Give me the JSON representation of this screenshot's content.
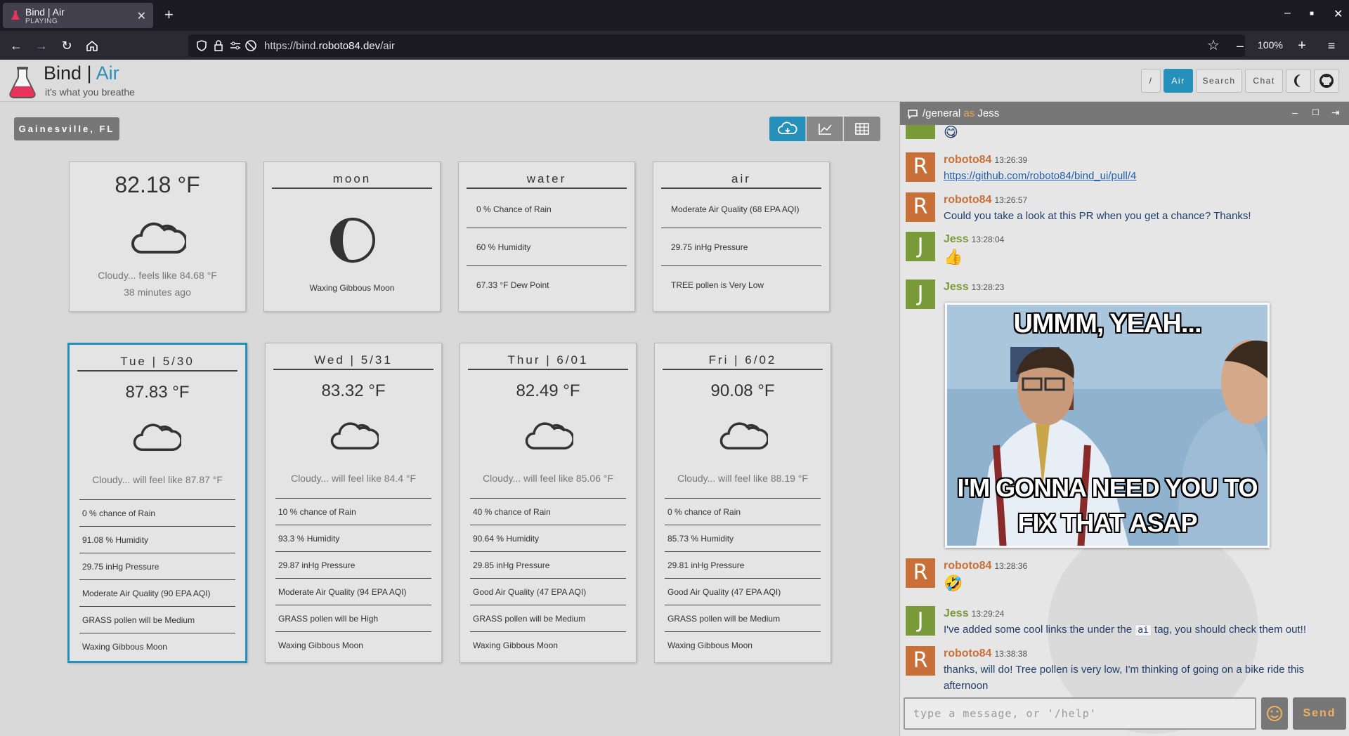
{
  "browser": {
    "tab_title": "Bind | Air",
    "tab_subtitle": "PLAYING",
    "url_prefix": "https://bind.",
    "url_domain": "roboto84.dev",
    "url_path": "/air",
    "zoom": "100%"
  },
  "app": {
    "brand_main": "Bind | ",
    "brand_accent": "Air",
    "tagline": "it's what you breathe",
    "nav": [
      {
        "label": "/"
      },
      {
        "label": "Air"
      },
      {
        "label": "Search"
      },
      {
        "label": "Chat"
      }
    ]
  },
  "location": "Gainesville, FL",
  "current": {
    "temp": "82.18 °F",
    "caption": "Cloudy... feels like 84.68 °F",
    "updated": "38 minutes ago"
  },
  "moon": {
    "title": "moon",
    "phase": "Waxing Gibbous Moon"
  },
  "water": {
    "title": "water",
    "rows": [
      "0 % Chance of Rain",
      "60 % Humidity",
      "67.33 °F Dew Point"
    ]
  },
  "air": {
    "title": "air",
    "rows": [
      "Moderate Air Quality (68 EPA AQI)",
      "29.75 inHg Pressure",
      "TREE pollen is Very Low"
    ]
  },
  "forecast": [
    {
      "day": "Tue | 5/30",
      "temp": "87.83 °F",
      "caption": "Cloudy... will feel like 87.87 °F",
      "rows": [
        "0 % chance of Rain",
        "91.08 % Humidity",
        "29.75 inHg Pressure",
        "Moderate Air Quality (90 EPA AQI)",
        "GRASS pollen will be Medium",
        "Waxing Gibbous Moon"
      ]
    },
    {
      "day": "Wed | 5/31",
      "temp": "83.32 °F",
      "caption": "Cloudy... will feel like 84.4 °F",
      "rows": [
        "10 % chance of Rain",
        "93.3 % Humidity",
        "29.87 inHg Pressure",
        "Moderate Air Quality (94 EPA AQI)",
        "GRASS pollen will be High",
        "Waxing Gibbous Moon"
      ]
    },
    {
      "day": "Thur | 6/01",
      "temp": "82.49 °F",
      "caption": "Cloudy... will feel like 85.06 °F",
      "rows": [
        "40 % chance of Rain",
        "90.64 % Humidity",
        "29.85 inHg Pressure",
        "Good Air Quality (47 EPA AQI)",
        "GRASS pollen will be Medium",
        "Waxing Gibbous Moon"
      ]
    },
    {
      "day": "Fri | 6/02",
      "temp": "90.08 °F",
      "caption": "Cloudy... will feel like 88.19 °F",
      "rows": [
        "0 % chance of Rain",
        "85.73 % Humidity",
        "29.81 inHg Pressure",
        "Good Air Quality (47 EPA AQI)",
        "GRASS pollen will be Medium",
        "Waxing Gibbous Moon"
      ]
    }
  ],
  "chat": {
    "channel": "/general",
    "as_word": "as",
    "user": "Jess",
    "messages": [
      {
        "avatar": "R",
        "user": "roboto84",
        "time": "13:26:39",
        "text": "https://github.com/roboto84/bind_ui/pull/4"
      },
      {
        "avatar": "R",
        "user": "roboto84",
        "time": "13:26:57",
        "text": "Could you take a look at this PR when you get a chance? Thanks!"
      },
      {
        "avatar": "J",
        "user": "Jess",
        "time": "13:28:04",
        "text": "👍"
      },
      {
        "avatar": "J",
        "user": "Jess",
        "time": "13:28:23",
        "text": ""
      },
      {
        "avatar": "R",
        "user": "roboto84",
        "time": "13:28:36",
        "text": "🤣"
      },
      {
        "avatar": "J",
        "user": "Jess",
        "time": "13:29:24",
        "text_before": "I've added some cool links the under the",
        "code": "ai",
        "text_after": "tag, you should check them out!!"
      },
      {
        "avatar": "R",
        "user": "roboto84",
        "time": "13:38:38",
        "text": "thanks, will do! Tree pollen is very low, I'm thinking of going on a bike ride this afternoon"
      }
    ],
    "meme_top": "UMMM, YEAH...",
    "meme_bottom_1": "I'M GONNA NEED YOU TO",
    "meme_bottom_2": "FIX THAT ASAP",
    "partial_emoji": "😋",
    "input_placeholder": "type a message, or '/help'",
    "send_label": "Send"
  },
  "colors": {
    "accent": "#2590ba",
    "roboto84": "#c96f38",
    "jess": "#7a9a3a"
  }
}
